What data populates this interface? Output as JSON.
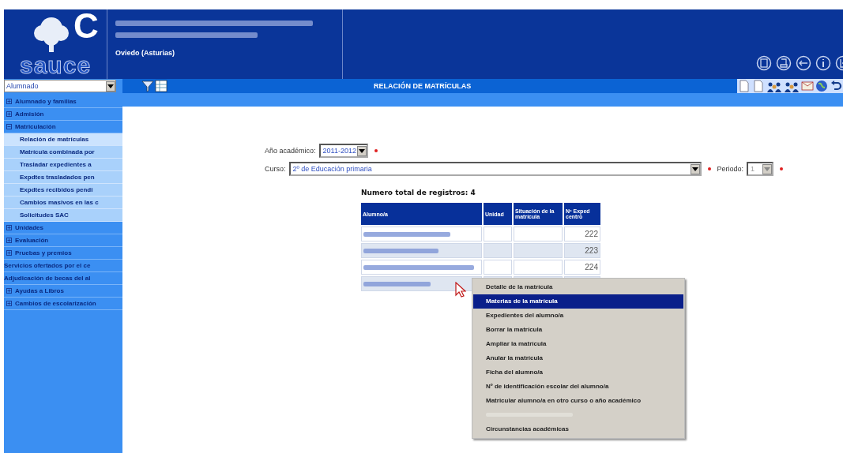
{
  "logo": {
    "letter": "C",
    "name": "sauce"
  },
  "header": {
    "location": "Oviedo (Asturias)"
  },
  "profile_select": {
    "value": "Alumnado"
  },
  "sidebar": {
    "items": [
      {
        "label": "Alumnado y familias",
        "kind": "group",
        "expanded": false
      },
      {
        "label": "Admisión",
        "kind": "group",
        "expanded": false
      },
      {
        "label": "Matriculación",
        "kind": "group",
        "expanded": true,
        "children": [
          {
            "label": "Relación de matrículas",
            "selected": true
          },
          {
            "label": "Matrícula combinada por",
            "selected": false
          },
          {
            "label": "Trasladar expedientes a",
            "selected": false
          },
          {
            "label": "Expdtes trasladados pen",
            "selected": false
          },
          {
            "label": "Expdtes recibidos pendi",
            "selected": false
          },
          {
            "label": "Cambios masivos en las c",
            "selected": false
          },
          {
            "label": "Solicitudes SAC",
            "selected": false
          }
        ]
      },
      {
        "label": "Unidades",
        "kind": "group",
        "expanded": false
      },
      {
        "label": "Evaluación",
        "kind": "group",
        "expanded": false
      },
      {
        "label": "Pruebas y premios",
        "kind": "group",
        "expanded": false
      },
      {
        "label": "Servicios ofertados por el ce",
        "kind": "link"
      },
      {
        "label": "Adjudicación de becas del al",
        "kind": "link"
      },
      {
        "label": "Ayudas a Libros",
        "kind": "group",
        "expanded": false
      },
      {
        "label": "Cambios de escolarización",
        "kind": "group",
        "expanded": false
      }
    ]
  },
  "page_title": "RELACIÓN DE MATRÍCULAS",
  "form": {
    "year_label": "Año académico:",
    "year": "2011-2012",
    "course_label": "Curso:",
    "course": "2º de Educación primaria",
    "period_label": "Periodo:",
    "period": "1"
  },
  "total": "Numero total de registros: 4",
  "table": {
    "columns": [
      "Alumno/a",
      "Unidad",
      "Situación de la matrícula",
      "Nº Exped centro"
    ],
    "rows": [
      {
        "expedient": "222"
      },
      {
        "expedient": "223"
      },
      {
        "expedient": "224"
      },
      {}
    ]
  },
  "context_menu": {
    "items": [
      {
        "label": "Detalle de la matrícula",
        "selected": false,
        "disabled": false
      },
      {
        "label": "Materias de la matrícula",
        "selected": true,
        "disabled": false
      },
      {
        "label": "Expedientes del alumno/a",
        "selected": false,
        "disabled": false
      },
      {
        "label": "Borrar la matrícula",
        "selected": false,
        "disabled": false
      },
      {
        "label": "Ampliar la matrícula",
        "selected": false,
        "disabled": false
      },
      {
        "label": "Anular la matrícula",
        "selected": false,
        "disabled": false
      },
      {
        "label": "Ficha del alumno/a",
        "selected": false,
        "disabled": false
      },
      {
        "label": "Nº de identificación escolar del alumno/a",
        "selected": false,
        "disabled": false
      },
      {
        "label": "Matricular alumno/a en otro curso o año académico",
        "selected": false,
        "disabled": false
      },
      {
        "selected": false,
        "disabled": true
      },
      {
        "label": "Circunstancias académicas",
        "selected": false,
        "disabled": false
      }
    ]
  }
}
